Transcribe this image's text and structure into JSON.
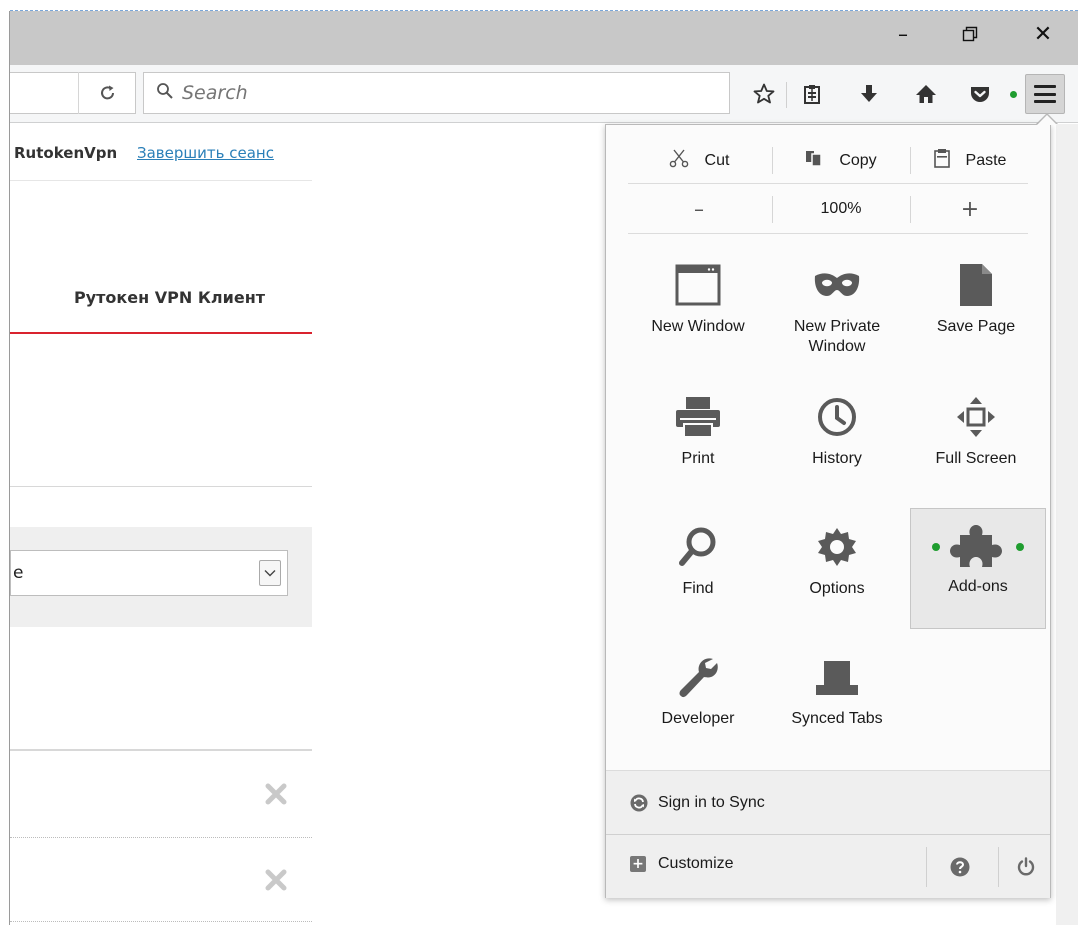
{
  "window": {
    "minimize_label": "–",
    "restore_label": "❐",
    "close_label": "✕"
  },
  "toolbar": {
    "search_placeholder": "Search",
    "icons": [
      "reload-icon",
      "bookmark-star-icon",
      "reading-list-icon",
      "downloads-icon",
      "home-icon",
      "pocket-icon",
      "menu-icon"
    ]
  },
  "page": {
    "user_name": "RutokenVpn",
    "logout_link": "Завершить сеанс",
    "app_title": "Рутокен VPN Клиент",
    "select_value": "e"
  },
  "menu_panel": {
    "edit": {
      "cut": "Cut",
      "copy": "Copy",
      "paste": "Paste"
    },
    "zoom": {
      "zoom_out": "–",
      "level": "100%",
      "zoom_in": "+"
    },
    "items": [
      {
        "label": "New Window",
        "icon": "new-window-icon"
      },
      {
        "label": "New Private Window",
        "icon": "private-mask-icon"
      },
      {
        "label": "Save Page",
        "icon": "save-page-icon"
      },
      {
        "label": "Print",
        "icon": "printer-icon"
      },
      {
        "label": "History",
        "icon": "clock-icon"
      },
      {
        "label": "Full Screen",
        "icon": "fullscreen-icon"
      },
      {
        "label": "Find",
        "icon": "magnifier-icon"
      },
      {
        "label": "Options",
        "icon": "gear-icon"
      },
      {
        "label": "Add-ons",
        "icon": "puzzle-icon"
      },
      {
        "label": "Developer",
        "icon": "wrench-icon"
      },
      {
        "label": "Synced Tabs",
        "icon": "synced-tabs-icon"
      }
    ],
    "sync_label": "Sign in to Sync",
    "customize_label": "Customize"
  },
  "colors": {
    "accent_red": "#d9232e",
    "link_blue": "#2a7fb8",
    "status_green": "#1f9d2f",
    "titlebar_gray": "#c8c8c8"
  }
}
